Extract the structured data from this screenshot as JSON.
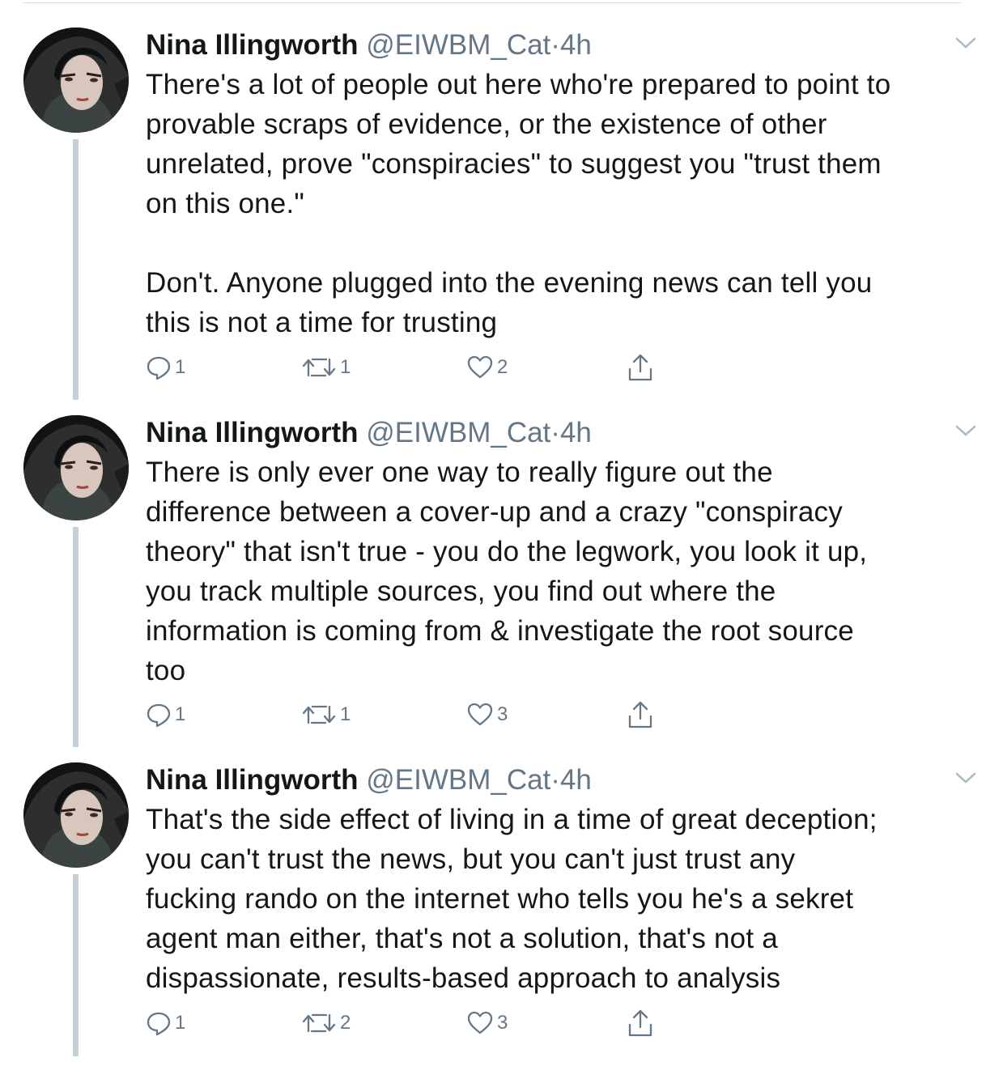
{
  "tweets": [
    {
      "author": "Nina Illingworth",
      "handle": "@EIWBM_Cat",
      "separator": "·",
      "time": "4h",
      "text": "There's a lot of people out here who're prepared to point to\nprovable scraps of evidence, or the existence of other\nunrelated, prove \"conspiracies\" to suggest you \"trust them\non this one.\"\n\nDon't. Anyone plugged into the evening news can tell you\nthis is not a time for trusting",
      "replies": "1",
      "retweets": "1",
      "likes": "2"
    },
    {
      "author": "Nina Illingworth",
      "handle": "@EIWBM_Cat",
      "separator": "·",
      "time": "4h",
      "text": "There is only ever one way to really figure out the\ndifference between a cover-up and a crazy \"conspiracy\ntheory\" that isn't true - you do the legwork, you look it up,\nyou track multiple sources, you find out where the\ninformation is coming from & investigate the root source\ntoo",
      "replies": "1",
      "retweets": "1",
      "likes": "3"
    },
    {
      "author": "Nina Illingworth",
      "handle": "@EIWBM_Cat",
      "separator": "·",
      "time": "4h",
      "text": "That's the side effect of living in a time of great deception;\nyou can't trust the news, but you can't just trust any\nfucking rando on the internet who tells you he's a sekret\nagent man either, that's not a solution, that's not a\ndispassionate, results-based approach to analysis",
      "replies": "1",
      "retweets": "2",
      "likes": "3"
    }
  ],
  "colors": {
    "text": "#14171a",
    "secondary": "#657786",
    "thread_line": "#c4cfd6",
    "divider": "#dcdfe2"
  },
  "icons": {
    "reply": "reply-icon",
    "retweet": "retweet-icon",
    "like": "heart-icon",
    "share": "share-icon",
    "more": "chevron-down-icon"
  }
}
